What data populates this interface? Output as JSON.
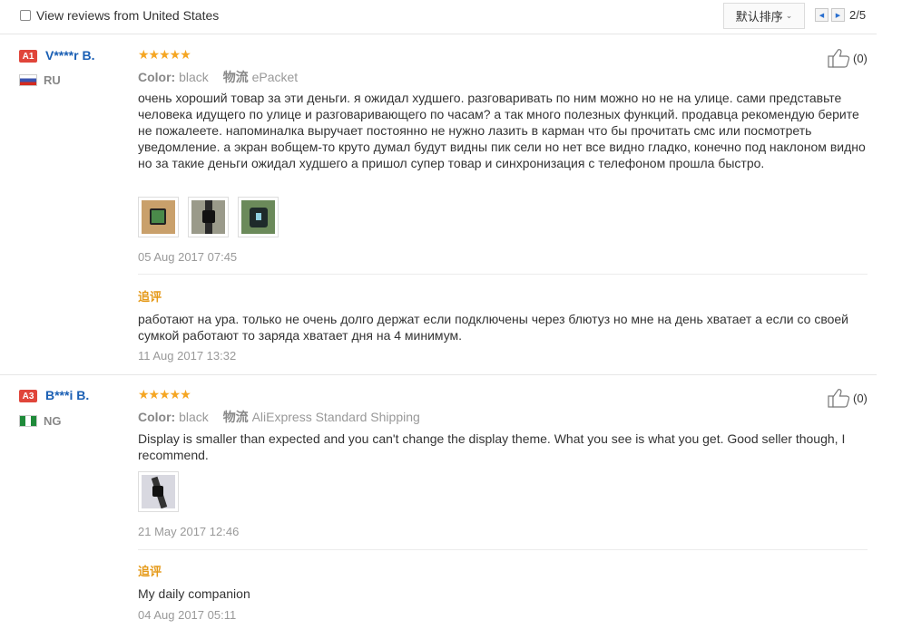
{
  "toolbar": {
    "filter_label": "View reviews from United States",
    "sort_label": "默认排序",
    "page_indicator": "2/5"
  },
  "reviews": [
    {
      "badge": "A1",
      "user": "V****r B.",
      "country": "RU",
      "rating": 5,
      "color_label": "Color:",
      "color_value": "black",
      "shipping_label": "物流",
      "shipping_value": "ePacket",
      "text": "очень хороший товар за эти деньги. я ожидал худшего. разговаривать по ним можно но не на улице. сами представьте человека идущего по улице и разговаривающего по часам? а так много полезных функций. продавца рекомендую берите не пожалеете. напоминалка выручает постоянно не нужно лазить в карман что бы прочитать смс или посмотреть уведомление. а экран вобщем-то круто думал будут видны пик сели но нет все видно гладко, конечно под наклоном видно но за такие деньги ожидал худшего а пришол супер товар и синхронизация с телефоном прошла быстро.",
      "date": "05 Aug 2017 07:45",
      "followup_label": "追评",
      "followup_text": "работают на ура. только не очень долго держат если подключены через блютуз но мне на день хватает а если со своей сумкой работают то заряда хватает дня на 4 минимум.",
      "followup_date": "11 Aug 2017 13:32",
      "helpful_count": "(0)"
    },
    {
      "badge": "A3",
      "user": "B***i B.",
      "country": "NG",
      "rating": 5,
      "color_label": "Color:",
      "color_value": "black",
      "shipping_label": "物流",
      "shipping_value": "AliExpress Standard Shipping",
      "text": "Display is smaller than expected and you can't change the display theme. What you see is what you get. Good seller though, I recommend.",
      "date": "21 May 2017 12:46",
      "followup_label": "追评",
      "followup_text": "My daily companion",
      "followup_date": "04 Aug 2017 05:11",
      "helpful_count": "(0)"
    }
  ],
  "colors": {
    "star": "#f5a623",
    "username": "#1a5fb4",
    "badge": "#e0453a",
    "followup": "#e59a1a"
  },
  "icons": {
    "thumbs_up": "thumbs-up-icon",
    "prev": "prev-page-icon",
    "next": "next-page-icon",
    "sort_chevron": "chevron-down-icon"
  }
}
